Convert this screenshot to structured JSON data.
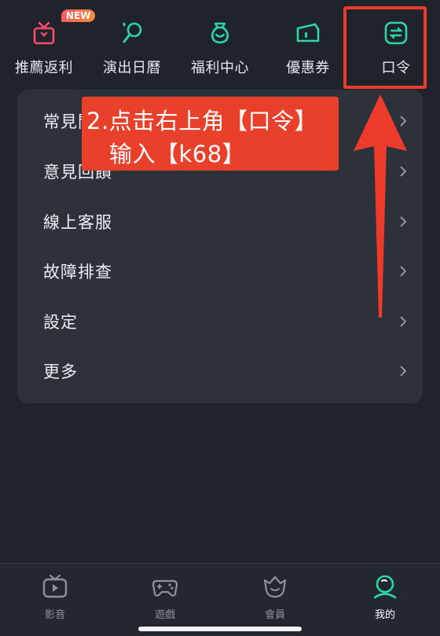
{
  "shortcuts": [
    {
      "label": "推薦返利",
      "icon": "gift-icon",
      "badge": "NEW"
    },
    {
      "label": "演出日曆",
      "icon": "microphone-icon"
    },
    {
      "label": "福利中心",
      "icon": "money-bag-icon"
    },
    {
      "label": "優惠券",
      "icon": "coupon-icon"
    },
    {
      "label": "口令",
      "icon": "code-swap-icon"
    }
  ],
  "menu": [
    {
      "label": "常見問題"
    },
    {
      "label": "意見回饋"
    },
    {
      "label": "線上客服"
    },
    {
      "label": "故障排查"
    },
    {
      "label": "設定"
    },
    {
      "label": "更多"
    }
  ],
  "annotation": {
    "line1": "2.点击右上角【口令】",
    "line2": "输入【k68】",
    "color": "#e8402a"
  },
  "bottom_nav": [
    {
      "label": "影音",
      "icon": "tv-icon",
      "active": false
    },
    {
      "label": "遊戲",
      "icon": "gamepad-icon",
      "active": false
    },
    {
      "label": "會員",
      "icon": "crown-icon",
      "active": false
    },
    {
      "label": "我的",
      "icon": "profile-icon",
      "active": true
    }
  ],
  "colors": {
    "background": "#1f232b",
    "card": "#2c313a",
    "accent": "#2fd6a3",
    "icon_pink": "#ff4d6d",
    "highlight": "#ec3b2a"
  }
}
